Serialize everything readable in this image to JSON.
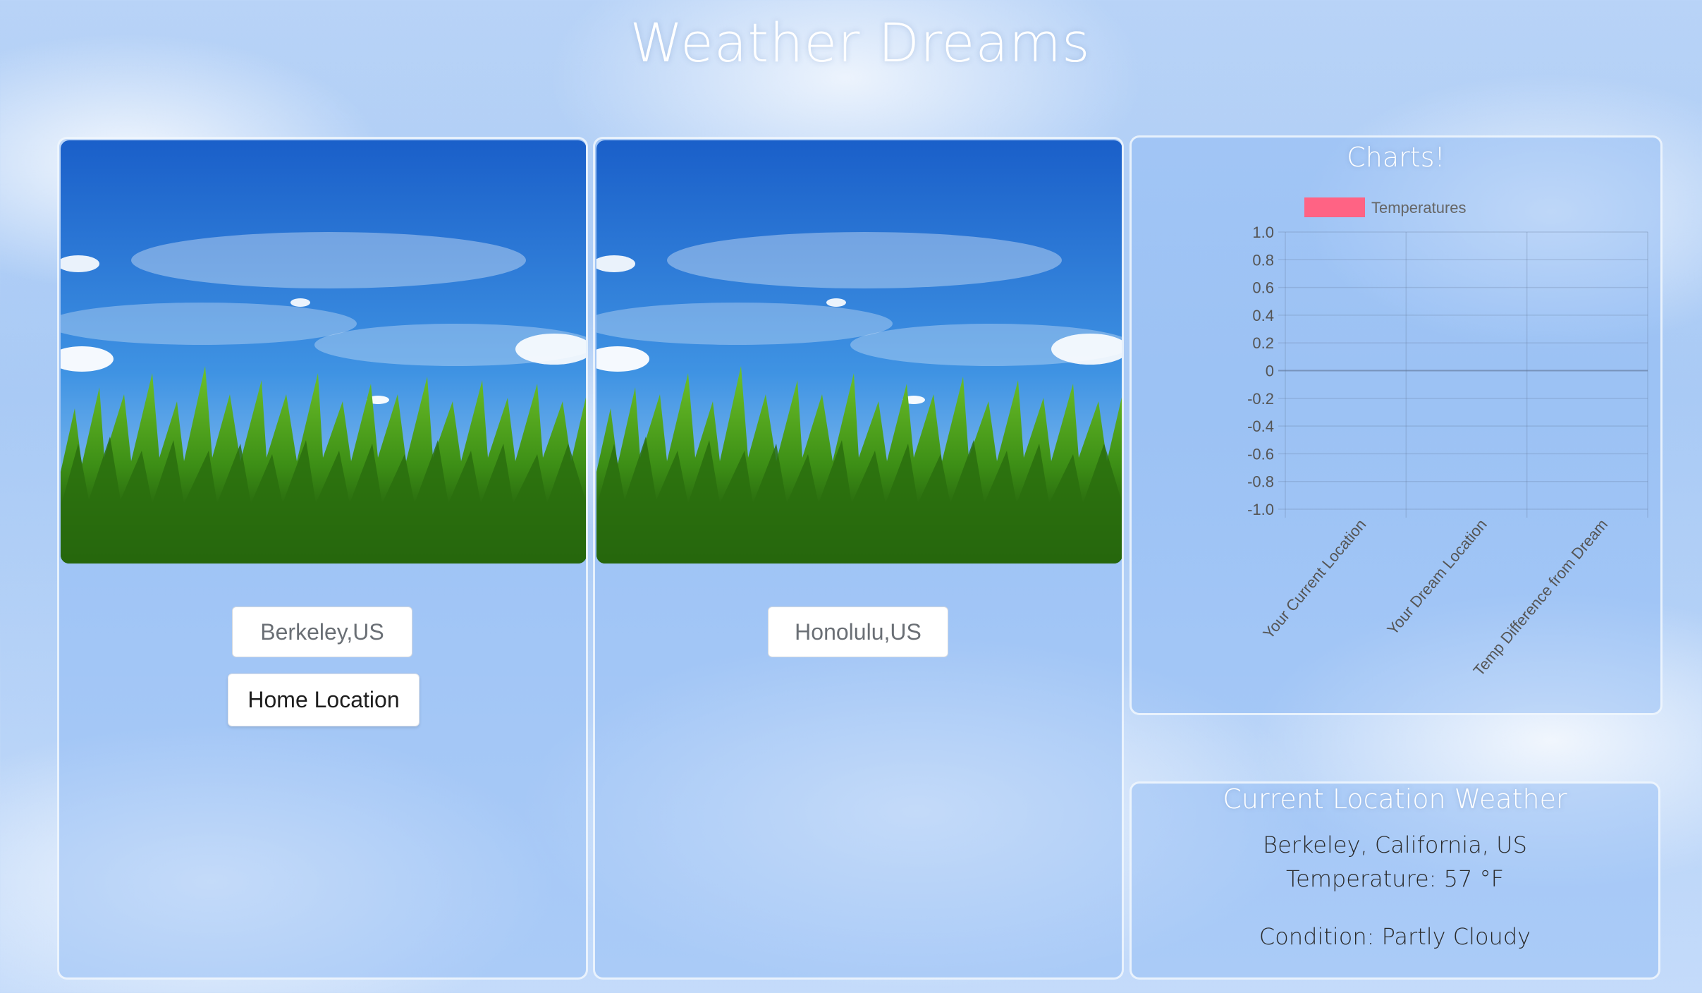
{
  "app": {
    "title": "Weather Dreams"
  },
  "home_panel": {
    "city_value": "Berkeley,US",
    "home_button_label": "Home Location"
  },
  "dream_panel": {
    "city_value": "Honolulu,US"
  },
  "charts_panel": {
    "heading": "Charts!"
  },
  "weather_panel": {
    "heading": "Current Location Weather",
    "location": "Berkeley, California, US",
    "temperature": "Temperature: 57 °F",
    "condition": "Condition: Partly Cloudy"
  },
  "colors": {
    "legend_swatch": "#ff6384",
    "panel_border": "#ffffff",
    "title_text": "#ffffff"
  },
  "chart_data": {
    "type": "bar",
    "categories": [
      "Your Current Location",
      "Your Dream Location",
      "Temp Difference from Dream"
    ],
    "series": [
      {
        "name": "Temperatures",
        "values": [
          null,
          null,
          null
        ],
        "color": "#ff6384"
      }
    ],
    "ylim": [
      -1.0,
      1.0
    ],
    "yticks": [
      "1.0",
      "0.8",
      "0.6",
      "0.4",
      "0.2",
      "0",
      "-0.2",
      "-0.4",
      "-0.6",
      "-0.8",
      "-1.0"
    ],
    "title": "",
    "xlabel": "",
    "ylabel": "",
    "grid": true,
    "legend_position": "top"
  }
}
